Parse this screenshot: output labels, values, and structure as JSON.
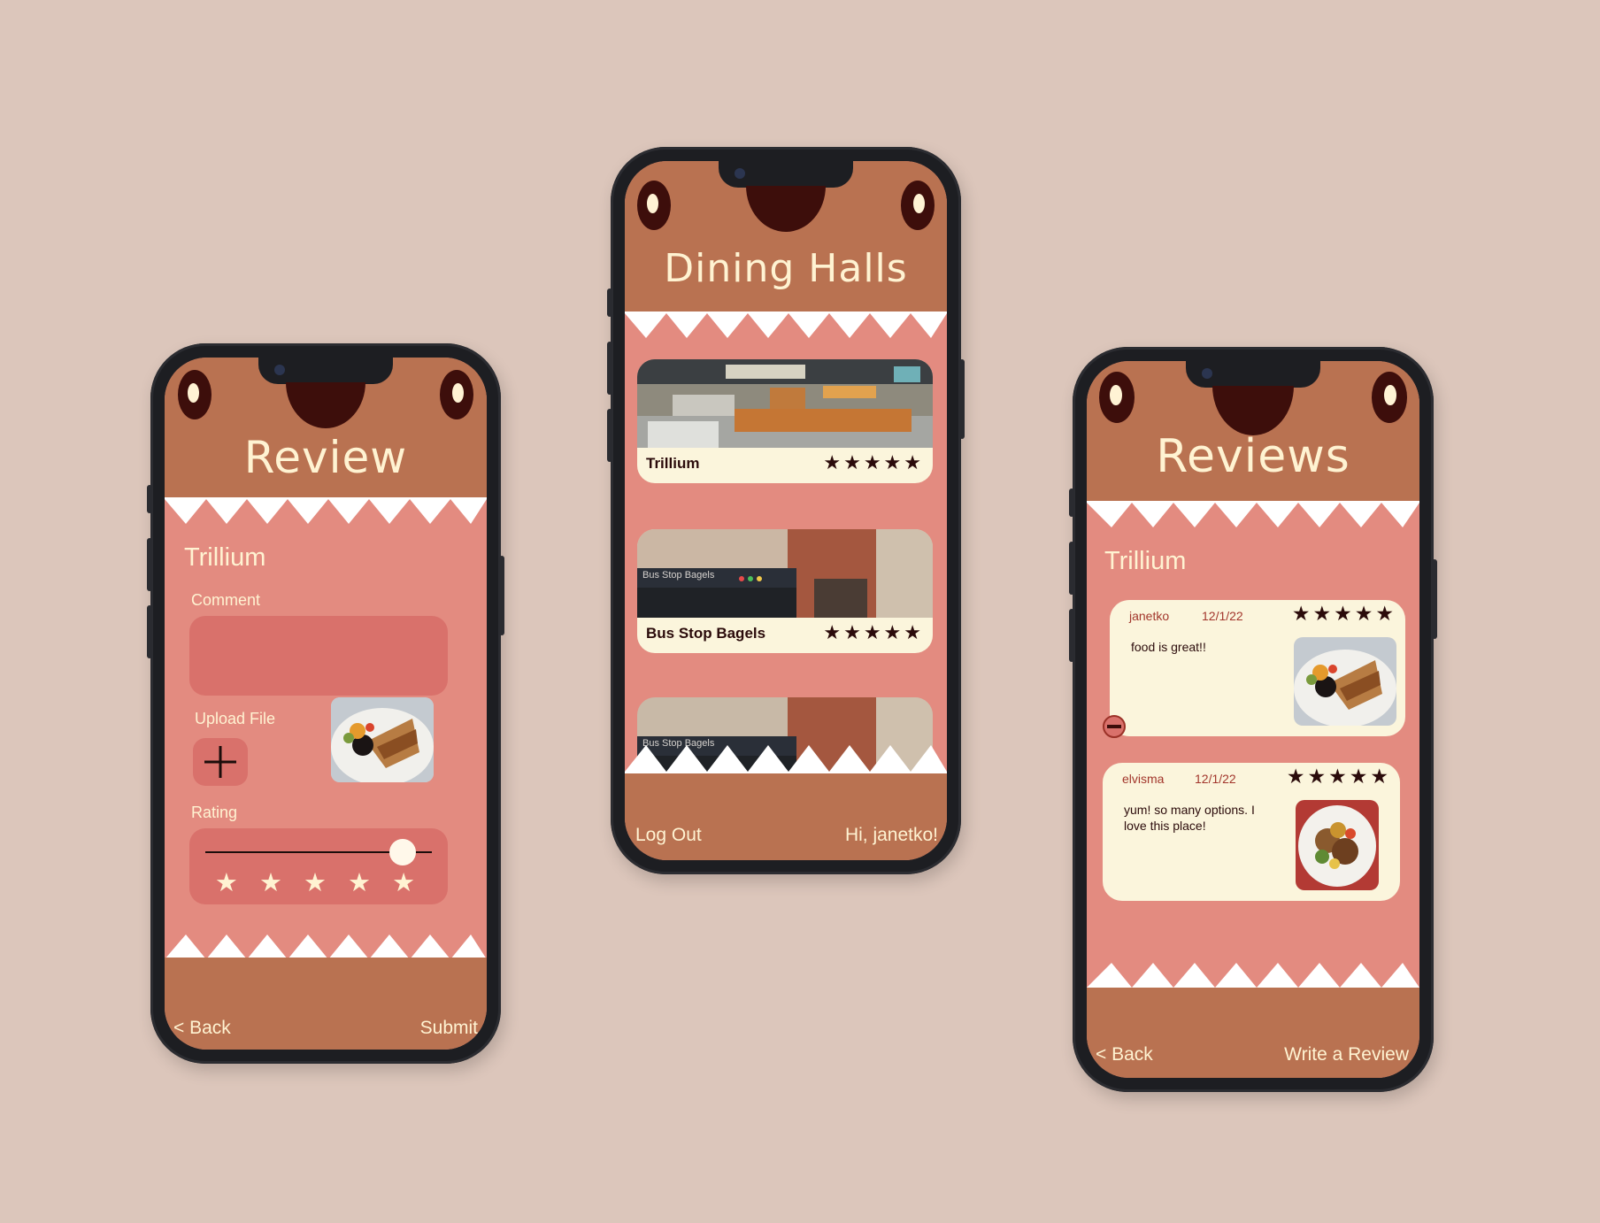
{
  "colors": {
    "background": "#dcc6bb",
    "header": "#b97251",
    "screen": "#e38b80",
    "card": "#fbf5dc",
    "field": "#d9716b",
    "dark": "#3d0e0b",
    "cream_text": "#fff3d2"
  },
  "review_screen": {
    "title": "Review",
    "place": "Trillium",
    "comment_label": "Comment",
    "upload_label": "Upload File",
    "upload_icon": "plus-icon",
    "rating_label": "Rating",
    "rating_stars": "★ ★ ★ ★ ★",
    "rating_value_fraction": 0.87,
    "back_label": "< Back",
    "submit_label": "Submit"
  },
  "dining_screen": {
    "title": "Dining Halls",
    "halls": [
      {
        "name": "Trillium",
        "stars": "★★★★★"
      },
      {
        "name": "Bus Stop Bagels",
        "stars": "★★★★★"
      }
    ],
    "sign_text": "Bus Stop Bagels",
    "logout_label": "Log Out",
    "greeting": "Hi, janetko!"
  },
  "reviews_screen": {
    "title": "Reviews",
    "place": "Trillium",
    "reviews": [
      {
        "user": "janetko",
        "date": "12/1/22",
        "stars": "★★★★★",
        "text": "food is great!!"
      },
      {
        "user": "elvisma",
        "date": "12/1/22",
        "stars": "★★★★★",
        "text": "yum! so many options. I love this place!"
      }
    ],
    "delete_icon": "minus-circle-icon",
    "back_label": "< Back",
    "write_label": "Write a Review"
  }
}
